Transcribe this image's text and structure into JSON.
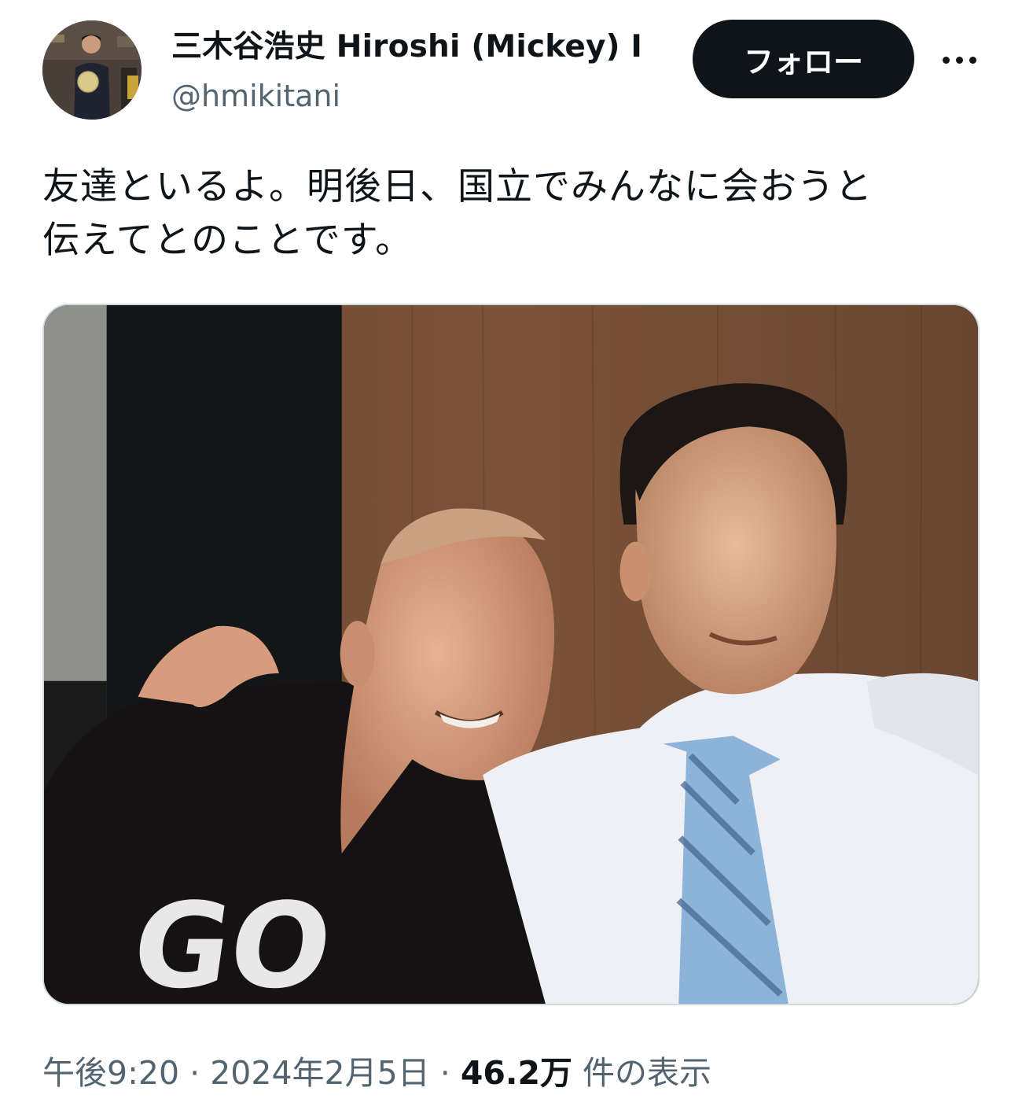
{
  "author": {
    "display_name": "三木谷浩史 Hiroshi (Mickey) I",
    "handle": "@hmikitani",
    "avatar_icon": "profile-photo-icon"
  },
  "actions": {
    "follow_label": "フォロー",
    "more_icon": "more-dots-icon"
  },
  "tweet": {
    "text": "友達といるよ。明後日、国立でみんなに会おうと\n伝えてとのことです。",
    "media_icon": "photo-image-icon"
  },
  "meta": {
    "time": "午後9:20",
    "separator1": " · ",
    "date": "2024年2月5日",
    "separator2": " · ",
    "views_count": "46.2万",
    "views_label": " 件の表示"
  },
  "colors": {
    "text_primary": "#0f1419",
    "text_secondary": "#536471",
    "button_bg": "#0f1419",
    "button_text": "#ffffff",
    "media_border": "#cfd9de"
  }
}
